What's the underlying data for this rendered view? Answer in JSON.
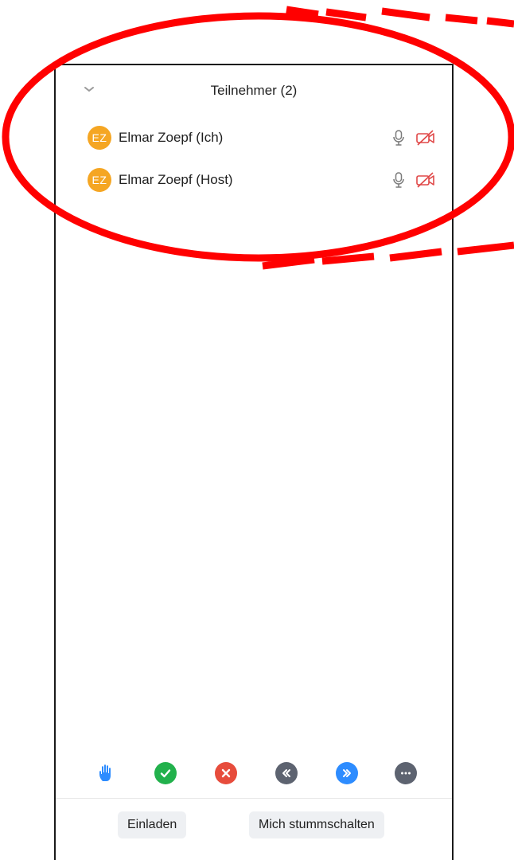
{
  "header": {
    "title": "Teilnehmer (2)"
  },
  "participants": [
    {
      "initials": "EZ",
      "name": "Elmar Zoepf (Ich)",
      "avatar_color": "#f5a623"
    },
    {
      "initials": "EZ",
      "name": "Elmar Zoepf (Host)",
      "avatar_color": "#f5a623"
    }
  ],
  "icons": {
    "collapse": "chevron-down-icon",
    "mic": "microphone-icon",
    "camera": "video-off-icon",
    "raise_hand": "raise-hand-icon",
    "yes": "checkmark-icon",
    "no": "cross-icon",
    "slower": "go-slower-icon",
    "faster": "go-faster-icon",
    "more": "more-icon"
  },
  "colors": {
    "hand": "#2d8cff",
    "yes": "#22b14c",
    "no": "#e74c3c",
    "slower": "#5d6370",
    "faster": "#2d8cff",
    "more": "#5d6370",
    "camera_off": "#e04848",
    "annotation": "#ff0000"
  },
  "footer": {
    "invite_label": "Einladen",
    "mute_label": "Mich stummschalten"
  }
}
